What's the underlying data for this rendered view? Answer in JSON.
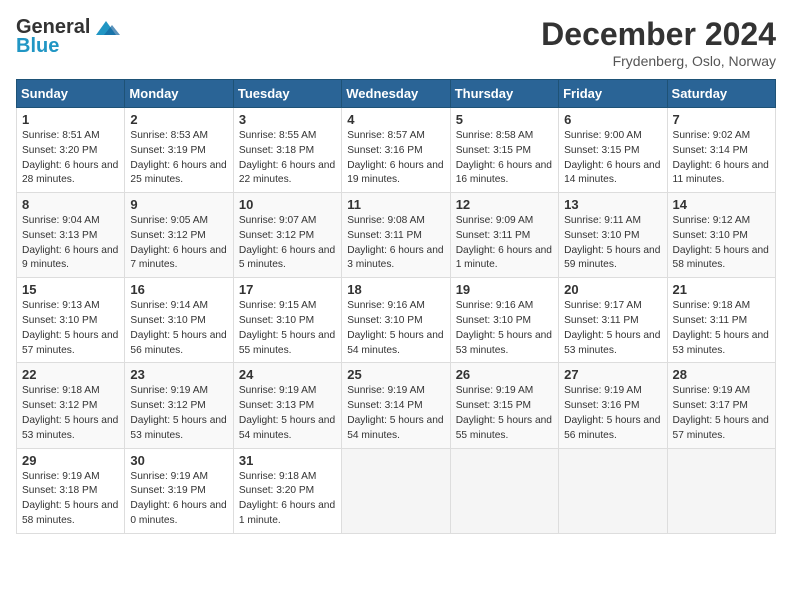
{
  "header": {
    "logo_general": "General",
    "logo_blue": "Blue",
    "month_title": "December 2024",
    "location": "Frydenberg, Oslo, Norway"
  },
  "days_of_week": [
    "Sunday",
    "Monday",
    "Tuesday",
    "Wednesday",
    "Thursday",
    "Friday",
    "Saturday"
  ],
  "weeks": [
    [
      {
        "day": "1",
        "sunrise": "8:51 AM",
        "sunset": "3:20 PM",
        "daylight": "6 hours and 28 minutes."
      },
      {
        "day": "2",
        "sunrise": "8:53 AM",
        "sunset": "3:19 PM",
        "daylight": "6 hours and 25 minutes."
      },
      {
        "day": "3",
        "sunrise": "8:55 AM",
        "sunset": "3:18 PM",
        "daylight": "6 hours and 22 minutes."
      },
      {
        "day": "4",
        "sunrise": "8:57 AM",
        "sunset": "3:16 PM",
        "daylight": "6 hours and 19 minutes."
      },
      {
        "day": "5",
        "sunrise": "8:58 AM",
        "sunset": "3:15 PM",
        "daylight": "6 hours and 16 minutes."
      },
      {
        "day": "6",
        "sunrise": "9:00 AM",
        "sunset": "3:15 PM",
        "daylight": "6 hours and 14 minutes."
      },
      {
        "day": "7",
        "sunrise": "9:02 AM",
        "sunset": "3:14 PM",
        "daylight": "6 hours and 11 minutes."
      }
    ],
    [
      {
        "day": "8",
        "sunrise": "9:04 AM",
        "sunset": "3:13 PM",
        "daylight": "6 hours and 9 minutes."
      },
      {
        "day": "9",
        "sunrise": "9:05 AM",
        "sunset": "3:12 PM",
        "daylight": "6 hours and 7 minutes."
      },
      {
        "day": "10",
        "sunrise": "9:07 AM",
        "sunset": "3:12 PM",
        "daylight": "6 hours and 5 minutes."
      },
      {
        "day": "11",
        "sunrise": "9:08 AM",
        "sunset": "3:11 PM",
        "daylight": "6 hours and 3 minutes."
      },
      {
        "day": "12",
        "sunrise": "9:09 AM",
        "sunset": "3:11 PM",
        "daylight": "6 hours and 1 minute."
      },
      {
        "day": "13",
        "sunrise": "9:11 AM",
        "sunset": "3:10 PM",
        "daylight": "5 hours and 59 minutes."
      },
      {
        "day": "14",
        "sunrise": "9:12 AM",
        "sunset": "3:10 PM",
        "daylight": "5 hours and 58 minutes."
      }
    ],
    [
      {
        "day": "15",
        "sunrise": "9:13 AM",
        "sunset": "3:10 PM",
        "daylight": "5 hours and 57 minutes."
      },
      {
        "day": "16",
        "sunrise": "9:14 AM",
        "sunset": "3:10 PM",
        "daylight": "5 hours and 56 minutes."
      },
      {
        "day": "17",
        "sunrise": "9:15 AM",
        "sunset": "3:10 PM",
        "daylight": "5 hours and 55 minutes."
      },
      {
        "day": "18",
        "sunrise": "9:16 AM",
        "sunset": "3:10 PM",
        "daylight": "5 hours and 54 minutes."
      },
      {
        "day": "19",
        "sunrise": "9:16 AM",
        "sunset": "3:10 PM",
        "daylight": "5 hours and 53 minutes."
      },
      {
        "day": "20",
        "sunrise": "9:17 AM",
        "sunset": "3:11 PM",
        "daylight": "5 hours and 53 minutes."
      },
      {
        "day": "21",
        "sunrise": "9:18 AM",
        "sunset": "3:11 PM",
        "daylight": "5 hours and 53 minutes."
      }
    ],
    [
      {
        "day": "22",
        "sunrise": "9:18 AM",
        "sunset": "3:12 PM",
        "daylight": "5 hours and 53 minutes."
      },
      {
        "day": "23",
        "sunrise": "9:19 AM",
        "sunset": "3:12 PM",
        "daylight": "5 hours and 53 minutes."
      },
      {
        "day": "24",
        "sunrise": "9:19 AM",
        "sunset": "3:13 PM",
        "daylight": "5 hours and 54 minutes."
      },
      {
        "day": "25",
        "sunrise": "9:19 AM",
        "sunset": "3:14 PM",
        "daylight": "5 hours and 54 minutes."
      },
      {
        "day": "26",
        "sunrise": "9:19 AM",
        "sunset": "3:15 PM",
        "daylight": "5 hours and 55 minutes."
      },
      {
        "day": "27",
        "sunrise": "9:19 AM",
        "sunset": "3:16 PM",
        "daylight": "5 hours and 56 minutes."
      },
      {
        "day": "28",
        "sunrise": "9:19 AM",
        "sunset": "3:17 PM",
        "daylight": "5 hours and 57 minutes."
      }
    ],
    [
      {
        "day": "29",
        "sunrise": "9:19 AM",
        "sunset": "3:18 PM",
        "daylight": "5 hours and 58 minutes."
      },
      {
        "day": "30",
        "sunrise": "9:19 AM",
        "sunset": "3:19 PM",
        "daylight": "6 hours and 0 minutes."
      },
      {
        "day": "31",
        "sunrise": "9:18 AM",
        "sunset": "3:20 PM",
        "daylight": "6 hours and 1 minute."
      },
      null,
      null,
      null,
      null
    ]
  ]
}
